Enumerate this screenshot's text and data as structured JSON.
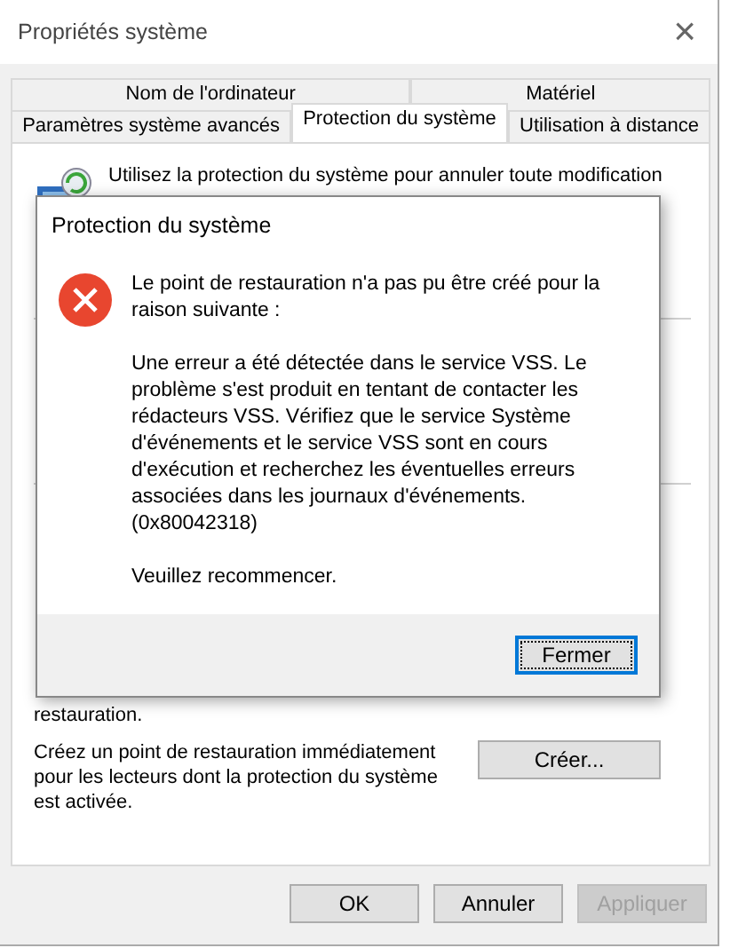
{
  "window": {
    "title": "Propriétés système",
    "close": "×"
  },
  "tabs": [
    [
      {
        "label": "Nom de l'ordinateur",
        "selected": false
      },
      {
        "label": "Matériel",
        "selected": false
      }
    ],
    [
      {
        "label": "Paramètres système avancés",
        "selected": false
      },
      {
        "label": "Protection du système",
        "selected": true
      },
      {
        "label": "Utilisation à distance",
        "selected": false
      }
    ]
  ],
  "panel": {
    "intro": "Utilisez la protection du système pour annuler toute modification",
    "restore_tail": "restauration.",
    "create_text": "Créez un point de restauration immédiatement pour les lecteurs dont la protection du système est activée.",
    "create_button": "Créer..."
  },
  "buttons": [
    {
      "label": "OK",
      "disabled": false
    },
    {
      "label": "Annuler",
      "disabled": false
    },
    {
      "label": "Appliquer",
      "disabled": true
    }
  ],
  "dialog": {
    "title": "Protection du système",
    "paragraphs": [
      "Le point de restauration n'a pas pu être créé pour la raison suivante :",
      "Une erreur a été détectée dans le service VSS. Le problème s'est produit en tentant de contacter les rédacteurs VSS. Vérifiez que le service Système d'événements et le service VSS sont en cours d'exécution et recherchez les éventuelles erreurs associées dans les journaux d'événements. (0x80042318)",
      "Veuillez recommencer."
    ],
    "button": "Fermer"
  }
}
